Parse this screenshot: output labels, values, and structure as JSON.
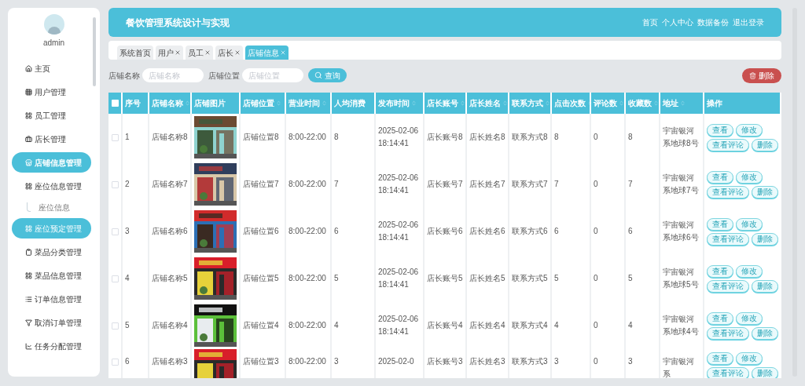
{
  "sidebar": {
    "user": "admin",
    "items": [
      {
        "label": "主页",
        "selected": false,
        "hovered": false
      },
      {
        "label": "用户管理",
        "selected": false,
        "hovered": false
      },
      {
        "label": "员工管理",
        "selected": false,
        "hovered": false
      },
      {
        "label": "店长管理",
        "selected": false,
        "hovered": false
      },
      {
        "label": "店铺信息管理",
        "selected": true,
        "hovered": false
      },
      {
        "label": "座位信息管理",
        "selected": false,
        "hovered": false,
        "expanded": true,
        "children": [
          {
            "label": "座位信息"
          }
        ]
      },
      {
        "label": "座位预定管理",
        "selected": false,
        "hovered": true
      },
      {
        "label": "菜品分类管理",
        "selected": false,
        "hovered": false
      },
      {
        "label": "菜品信息管理",
        "selected": false,
        "hovered": false
      },
      {
        "label": "订单信息管理",
        "selected": false,
        "hovered": false
      },
      {
        "label": "取消订单管理",
        "selected": false,
        "hovered": false
      },
      {
        "label": "任务分配管理",
        "selected": false,
        "hovered": false
      }
    ]
  },
  "header": {
    "title": "餐饮管理系统设计与实现",
    "links": [
      "首页",
      "个人中心",
      "数据备份",
      "退出登录"
    ]
  },
  "tabs": [
    {
      "label": "系统首页",
      "closable": false,
      "selected": false
    },
    {
      "label": "用户",
      "closable": true,
      "selected": false
    },
    {
      "label": "员工",
      "closable": true,
      "selected": false
    },
    {
      "label": "店长",
      "closable": true,
      "selected": false
    },
    {
      "label": "店铺信息",
      "closable": true,
      "selected": true
    }
  ],
  "search": {
    "fields": [
      {
        "label": "店铺名称",
        "placeholder": "店铺名称"
      },
      {
        "label": "店铺位置",
        "placeholder": "店铺位置"
      }
    ],
    "button": "查询",
    "delete_button": "删除"
  },
  "table": {
    "select_all_checked": false,
    "columns": [
      {
        "label": "序号",
        "sortable": false
      },
      {
        "label": "店铺名称",
        "sortable": true
      },
      {
        "label": "店铺图片",
        "sortable": false
      },
      {
        "label": "店铺位置",
        "sortable": true
      },
      {
        "label": "营业时间",
        "sortable": true
      },
      {
        "label": "人均消费",
        "sortable": false
      },
      {
        "label": "发布时间",
        "sortable": true
      },
      {
        "label": "店长账号",
        "sortable": true
      },
      {
        "label": "店长姓名",
        "sortable": true
      },
      {
        "label": "联系方式",
        "sortable": true
      },
      {
        "label": "点击次数",
        "sortable": true
      },
      {
        "label": "评论数",
        "sortable": true
      },
      {
        "label": "收藏数",
        "sortable": true
      },
      {
        "label": "地址",
        "sortable": true
      },
      {
        "label": "操作",
        "sortable": false
      }
    ],
    "rows": [
      {
        "checked": false,
        "cells": [
          "1",
          "店铺名称8",
          "",
          "店铺位置8",
          "8:00-22:00",
          "8",
          "2025-02-06 18:14:41",
          "店长账号8",
          "店长姓名8",
          "联系方式8",
          "8",
          "0",
          "8",
          "宇宙银河系地球8号"
        ],
        "actions": [
          "查看",
          "修改",
          "查看评论",
          "删除"
        ]
      },
      {
        "checked": false,
        "cells": [
          "2",
          "店铺名称7",
          "",
          "店铺位置7",
          "8:00-22:00",
          "7",
          "2025-02-06 18:14:41",
          "店长账号7",
          "店长姓名7",
          "联系方式7",
          "7",
          "0",
          "7",
          "宇宙银河系地球7号"
        ],
        "actions": [
          "查看",
          "修改",
          "查看评论",
          "删除"
        ]
      },
      {
        "checked": false,
        "cells": [
          "3",
          "店铺名称6",
          "",
          "店铺位置6",
          "8:00-22:00",
          "6",
          "2025-02-06 18:14:41",
          "店长账号6",
          "店长姓名6",
          "联系方式6",
          "6",
          "0",
          "6",
          "宇宙银河系地球6号"
        ],
        "actions": [
          "查看",
          "修改",
          "查看评论",
          "删除"
        ]
      },
      {
        "checked": false,
        "cells": [
          "4",
          "店铺名称5",
          "",
          "店铺位置5",
          "8:00-22:00",
          "5",
          "2025-02-06 18:14:41",
          "店长账号5",
          "店长姓名5",
          "联系方式5",
          "5",
          "0",
          "5",
          "宇宙银河系地球5号"
        ],
        "actions": [
          "查看",
          "修改",
          "查看评论",
          "删除"
        ]
      },
      {
        "checked": false,
        "cells": [
          "5",
          "店铺名称4",
          "",
          "店铺位置4",
          "8:00-22:00",
          "4",
          "2025-02-06 18:14:41",
          "店长账号4",
          "店长姓名4",
          "联系方式4",
          "4",
          "0",
          "4",
          "宇宙银河系地球4号"
        ],
        "actions": [
          "查看",
          "修改",
          "查看评论",
          "删除"
        ]
      },
      {
        "checked": false,
        "cells": [
          "6",
          "店铺名称3",
          "",
          "店铺位置3",
          "8:00-22:00",
          "3",
          "2025-02-0",
          "店长账号3",
          "店长姓名3",
          "联系方式3",
          "3",
          "0",
          "3",
          "宇宙银河系"
        ],
        "actions": [
          "查看",
          "修改",
          "查看评论",
          "删除"
        ]
      }
    ]
  }
}
